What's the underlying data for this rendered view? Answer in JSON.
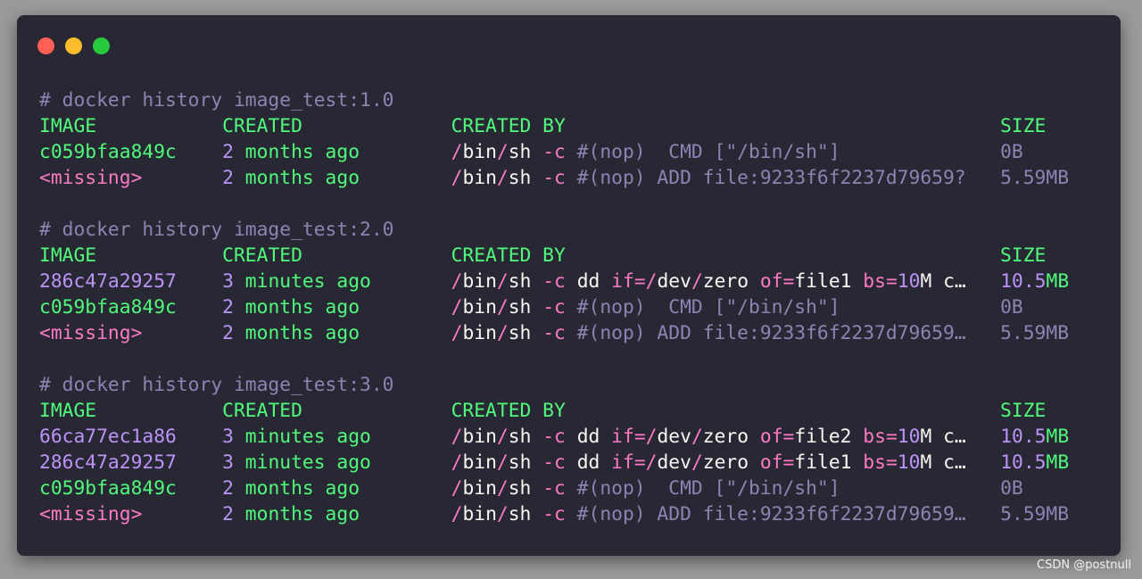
{
  "window": {
    "buttons": [
      {
        "name": "close",
        "color": "#ff5f56"
      },
      {
        "name": "minimize",
        "color": "#ffbd2e"
      },
      {
        "name": "maximize",
        "color": "#27c93f"
      }
    ]
  },
  "blocks": [
    {
      "command": "# docker history image_test:1.0",
      "headers": {
        "image": "IMAGE",
        "created": "CREATED",
        "created_by": "CREATED BY",
        "size": "SIZE"
      },
      "rows": [
        {
          "image": "c059bfaa849c",
          "created": "2 months ago",
          "created_by": "/bin/sh -c #(nop)  CMD [\"/bin/sh\"]",
          "size": "0B"
        },
        {
          "image": "<missing>",
          "created": "2 months ago",
          "created_by": "/bin/sh -c #(nop) ADD file:9233f6f2237d79659?",
          "size": "5.59MB"
        }
      ]
    },
    {
      "command": "# docker history image_test:2.0",
      "headers": {
        "image": "IMAGE",
        "created": "CREATED",
        "created_by": "CREATED BY",
        "size": "SIZE"
      },
      "rows": [
        {
          "image": "286c47a29257",
          "created": "3 minutes ago",
          "created_by": "/bin/sh -c dd if=/dev/zero of=file1 bs=10M c…",
          "size": "10.5MB"
        },
        {
          "image": "c059bfaa849c",
          "created": "2 months ago",
          "created_by": "/bin/sh -c #(nop)  CMD [\"/bin/sh\"]",
          "size": "0B"
        },
        {
          "image": "<missing>",
          "created": "2 months ago",
          "created_by": "/bin/sh -c #(nop) ADD file:9233f6f2237d79659…",
          "size": "5.59MB"
        }
      ]
    },
    {
      "command": "# docker history image_test:3.0",
      "headers": {
        "image": "IMAGE",
        "created": "CREATED",
        "created_by": "CREATED BY",
        "size": "SIZE"
      },
      "rows": [
        {
          "image": "66ca77ec1a86",
          "created": "3 minutes ago",
          "created_by": "/bin/sh -c dd if=/dev/zero of=file2 bs=10M c…",
          "size": "10.5MB"
        },
        {
          "image": "286c47a29257",
          "created": "3 minutes ago",
          "created_by": "/bin/sh -c dd if=/dev/zero of=file1 bs=10M c…",
          "size": "10.5MB"
        },
        {
          "image": "c059bfaa849c",
          "created": "2 months ago",
          "created_by": "/bin/sh -c #(nop)  CMD [\"/bin/sh\"]",
          "size": "0B"
        },
        {
          "image": "<missing>",
          "created": "2 months ago",
          "created_by": "/bin/sh -c #(nop) ADD file:9233f6f2237d79659…",
          "size": "5.59MB"
        }
      ]
    }
  ],
  "watermark": "CSDN @postnull"
}
